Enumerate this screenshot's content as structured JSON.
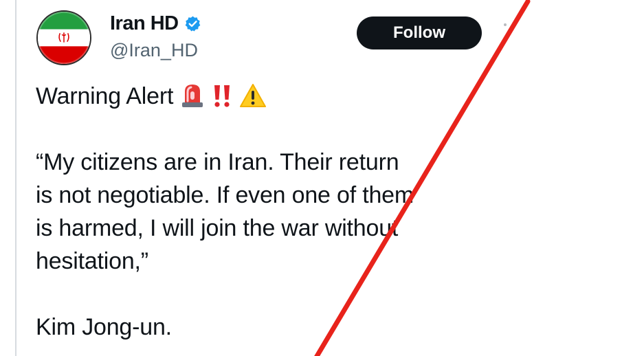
{
  "tweet": {
    "author": {
      "display_name": "Iran HD",
      "handle": "@Iran_HD",
      "verified": true,
      "avatar_icon": "iran-flag-icon"
    },
    "follow_label": "Follow",
    "headline": "Warning Alert",
    "headline_emojis": [
      "siren-icon",
      "double-exclamation-icon",
      "warning-sign-icon"
    ],
    "quote_lines": [
      "“My citizens are in Iran. Their return",
      "is not negotiable. If even one of them",
      "is harmed, I will join the war without",
      "hesitation,”"
    ],
    "attribution": "Kim Jong-un."
  },
  "overlay": {
    "icon": "red-strike-line",
    "color": "#e8231b"
  },
  "colors": {
    "text": "#0f1419",
    "secondary_text": "#536471",
    "verified_blue": "#1d9bf0",
    "follow_button_bg": "#0f1419",
    "flag_green": "#239f40",
    "flag_red": "#da0000"
  }
}
